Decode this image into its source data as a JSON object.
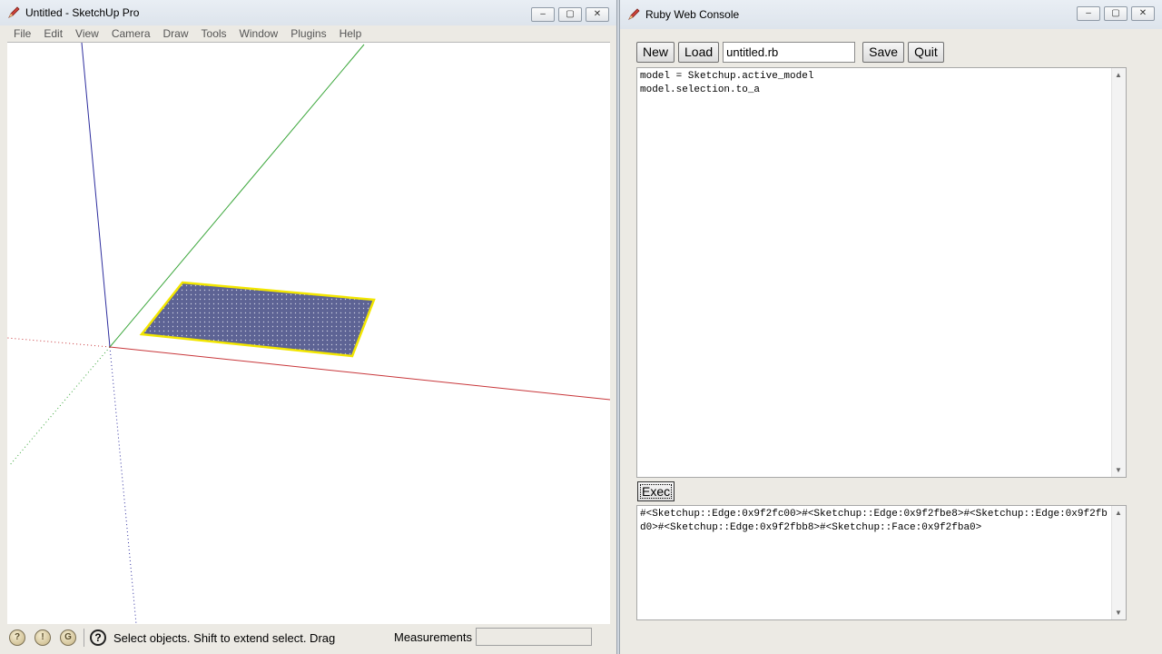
{
  "sketchup": {
    "title": "Untitled - SketchUp Pro",
    "menu": [
      "File",
      "Edit",
      "View",
      "Camera",
      "Draw",
      "Tools",
      "Window",
      "Plugins",
      "Help"
    ],
    "status_text": "Select objects. Shift to extend select. Drag",
    "measurements_label": "Measurements",
    "measurements_value": ""
  },
  "console": {
    "title": "Ruby Web Console",
    "new_label": "New",
    "load_label": "Load",
    "filename": "untitled.rb",
    "save_label": "Save",
    "quit_label": "Quit",
    "code": "model = Sketchup.active_model\nmodel.selection.to_a",
    "exec_label": "Exec",
    "output": "#<Sketchup::Edge:0x9f2fc00>#<Sketchup::Edge:0x9f2fbe8>#<Sketchup::Edge:0x9f2fbd0>#<Sketchup::Edge:0x9f2fbb8>#<Sketchup::Face:0x9f2fba0>"
  },
  "colors": {
    "red_axis": "#c8363a",
    "green_axis": "#3aa63a",
    "blue_axis": "#2e2e9e",
    "face_fill": "#5d6394",
    "selection": "#f2e600"
  },
  "icons": {
    "title_icon": "sketchup-pencil-icon",
    "status_icons": [
      "geolocation-icon",
      "credits-icon",
      "google-icon"
    ],
    "help_icon": "question-icon"
  }
}
